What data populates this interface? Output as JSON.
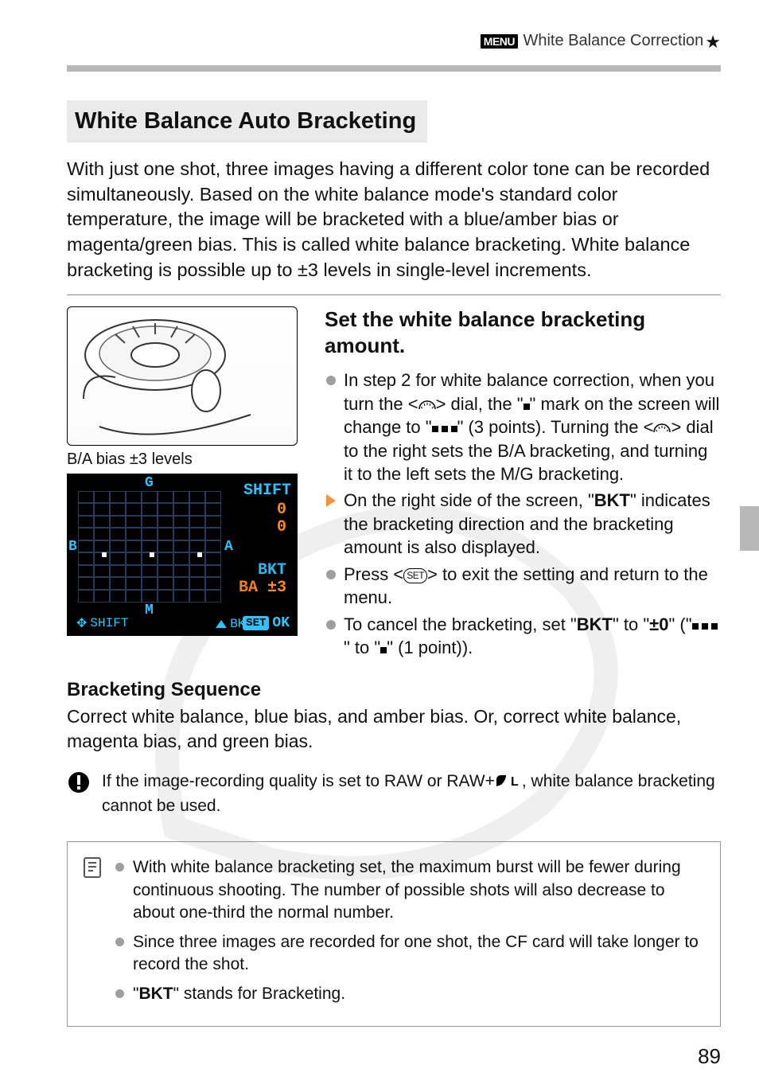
{
  "header": {
    "menu_badge": "MENU",
    "title": "White Balance Correction",
    "star": "★"
  },
  "section_title": "White Balance Auto Bracketing",
  "intro": "With just one shot, three images having a different color tone can be recorded simultaneously. Based on the white balance mode's standard color temperature, the image will be bracketed with a blue/amber bias or magenta/green bias. This is called white balance bracketing. White balance bracketing is possible up to ±3 levels in single-level increments.",
  "caption_ba": "B/A bias ±3 levels",
  "lcd": {
    "g": "G",
    "b": "B",
    "a": "A",
    "m": "M",
    "shift": "SHIFT",
    "val0a": "0",
    "val0b": "0",
    "bkt_label": "BKT",
    "ba_amt": "BA ±3",
    "bottom_shift": "SHIFT",
    "bottom_bkt": "BKT",
    "set": "SET",
    "ok": "OK"
  },
  "step_heading": "Set the white balance bracketing amount.",
  "bullets": [
    {
      "kind": "dot",
      "pre": "In step 2 for white balance correction, when you turn the <",
      "mid1": "> dial, the \"",
      "mid2": "\" mark on the screen will change to \"",
      "mid3": "\" (3 points). Turning the <",
      "post": "> dial to the right sets the B/A bracketing, and turning it to the left sets the M/G bracketing."
    },
    {
      "kind": "arrow",
      "text_a": "On the right side of the screen, \"",
      "bold_a": "BKT",
      "text_b": "\" indicates the bracketing direction and the bracketing amount is also displayed."
    },
    {
      "kind": "dot",
      "text_a": "Press <",
      "set": "SET",
      "text_b": "> to exit the setting and return to the menu."
    },
    {
      "kind": "dot",
      "text_a": "To cancel the bracketing, set \"",
      "bold_a": "BKT",
      "text_b": "\" to \"",
      "bold_b": "±0",
      "text_c": "\" (\"",
      "text_d": "\" to \"",
      "text_e": "\" (1 point))."
    }
  ],
  "seq_heading": "Bracketing Sequence",
  "seq_body": "Correct white balance, blue bias, and amber bias. Or, correct white balance, magenta bias, and green bias.",
  "warning": {
    "pre": "If the image-recording quality is set to RAW or RAW+",
    "post": ", white balance bracketing cannot be used.",
    "jpeg_letter": "L"
  },
  "notes": [
    "With white balance bracketing set, the maximum burst will be fewer during continuous shooting. The number of possible shots will also decrease to about one-third the normal number.",
    "Since three images are recorded for one shot, the CF card will take longer to record the shot."
  ],
  "note_bkt": {
    "quote_open": "\"",
    "bkt": "BKT",
    "tail": "\" stands for Bracketing."
  },
  "page_number": "89"
}
